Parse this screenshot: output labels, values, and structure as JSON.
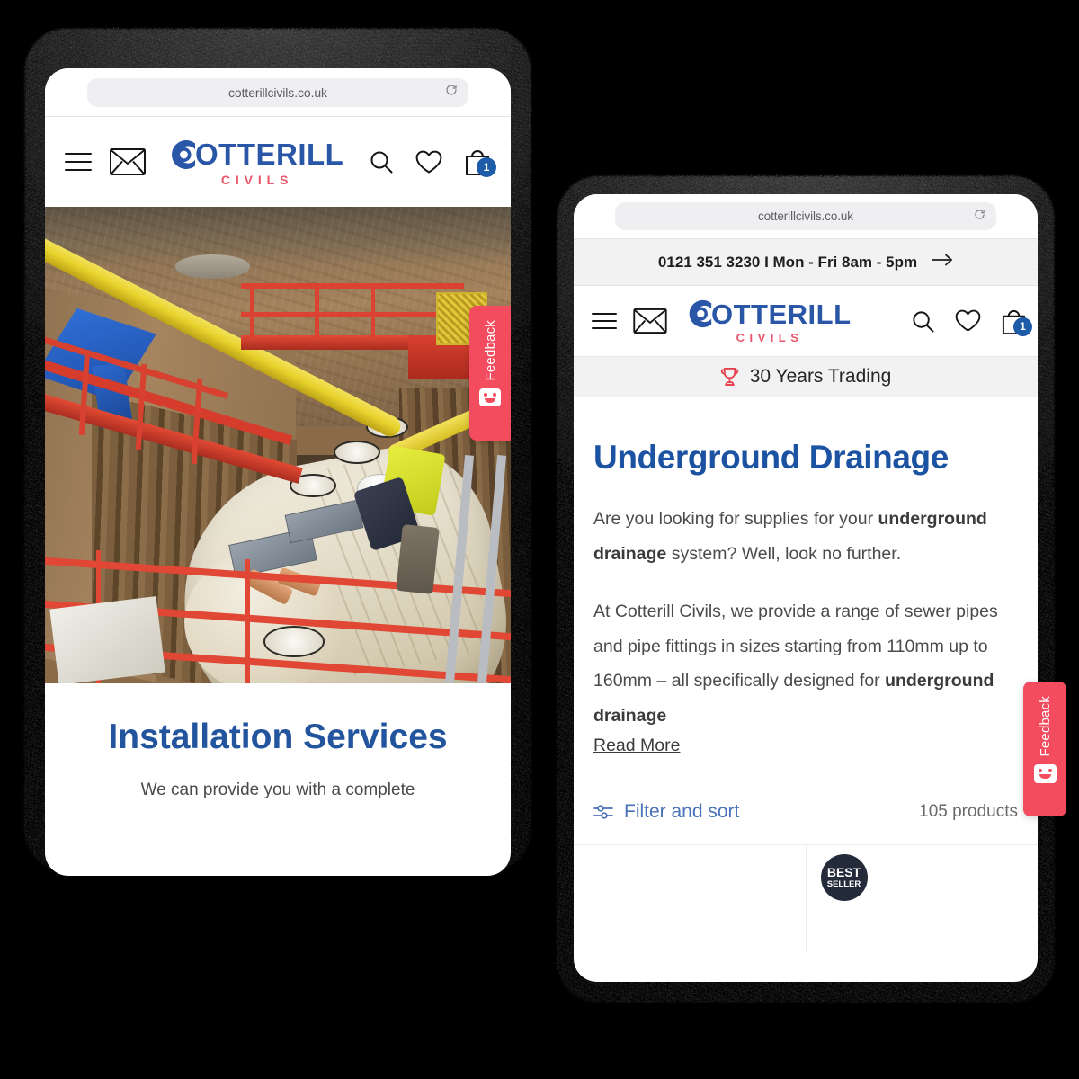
{
  "browser": {
    "url": "cotterillcivils.co.uk",
    "reload_icon": "reload-icon"
  },
  "left_device": {
    "header": {
      "menu_icon": "hamburger-menu-icon",
      "mail_icon": "envelope-icon",
      "logo_word": "OTTERILL",
      "logo_mark": "C",
      "logo_tagline": "CIVILS",
      "search_icon": "search-icon",
      "wishlist_icon": "heart-icon",
      "cart_icon": "shopping-bag-icon",
      "cart_count": "1"
    },
    "hero": {
      "alt": "construction-trench-with-storage-tank"
    },
    "content": {
      "title": "Installation Services",
      "subtitle": "We can provide you with a complete"
    },
    "feedback": {
      "label": "Feedback",
      "icon": "smiley-face-icon",
      "color": "#f24c5e"
    }
  },
  "right_device": {
    "announcement": {
      "text": "0121 351 3230 I Mon - Fri 8am - 5pm",
      "arrow_icon": "arrow-right-icon"
    },
    "header": {
      "menu_icon": "hamburger-menu-icon",
      "mail_icon": "envelope-icon",
      "logo_word": "OTTERILL",
      "logo_mark": "C",
      "logo_tagline": "CIVILS",
      "search_icon": "search-icon",
      "wishlist_icon": "heart-icon",
      "cart_icon": "shopping-bag-icon",
      "cart_count": "1"
    },
    "trustbar": {
      "icon": "trophy-icon",
      "text": "30 Years Trading"
    },
    "content": {
      "heading": "Underground Drainage",
      "para1_a": "Are you looking for supplies for your ",
      "para1_b": "underground drainage",
      "para1_c": " system? Well, look no further.",
      "para2_a": "At Cotterill Civils, we provide a range of sewer pipes and pipe fittings in sizes starting from 110mm up to 160mm – all specifically designed for ",
      "para2_b": "underground drainage",
      "read_more": "Read More"
    },
    "filter": {
      "icon": "filter-sliders-icon",
      "label": "Filter and sort",
      "product_count": "105 products"
    },
    "products": [
      {
        "badge": ""
      },
      {
        "badge_line1": "BEST",
        "badge_line2": "SELLER"
      }
    ],
    "feedback": {
      "label": "Feedback",
      "icon": "smiley-face-icon",
      "color": "#f24c5e"
    }
  },
  "colors": {
    "brand_blue": "#23549e",
    "brand_red": "#e8566a",
    "feedback_red": "#f24c5e",
    "badge_blue": "#1e5ba8",
    "bestseller_dark": "#232b3a",
    "background": "#000000"
  }
}
